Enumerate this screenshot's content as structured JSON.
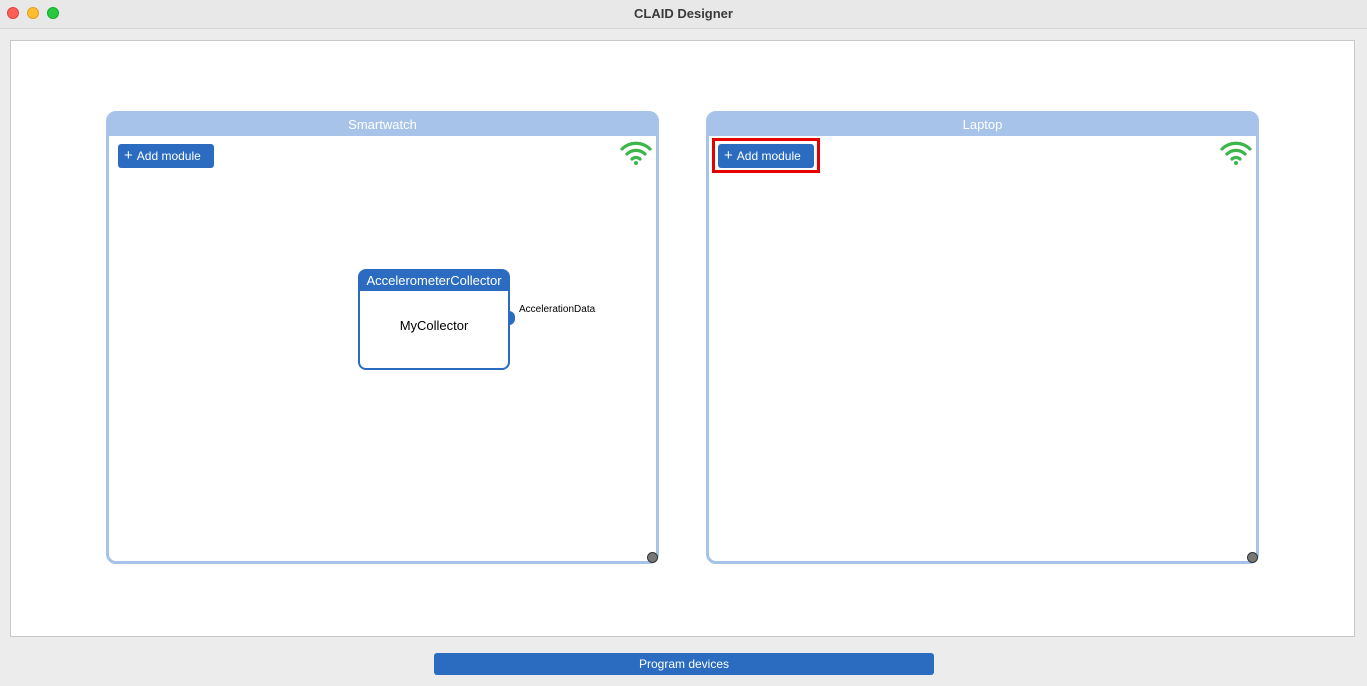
{
  "window": {
    "title": "CLAID Designer"
  },
  "colors": {
    "accent": "#2b6cc0",
    "device_border": "#a7c3e9",
    "wifi": "#3cb54a",
    "highlight": "#e40000"
  },
  "devices": [
    {
      "name": "Smartwatch",
      "add_label": "Add module",
      "status_icon": "wifi-icon",
      "modules": [
        {
          "type": "AccelerometerCollector",
          "name": "MyCollector",
          "output_channel": "AccelerationData"
        }
      ]
    },
    {
      "name": "Laptop",
      "add_label": "Add module",
      "status_icon": "wifi-icon",
      "modules": []
    }
  ],
  "footer": {
    "program_label": "Program devices"
  }
}
